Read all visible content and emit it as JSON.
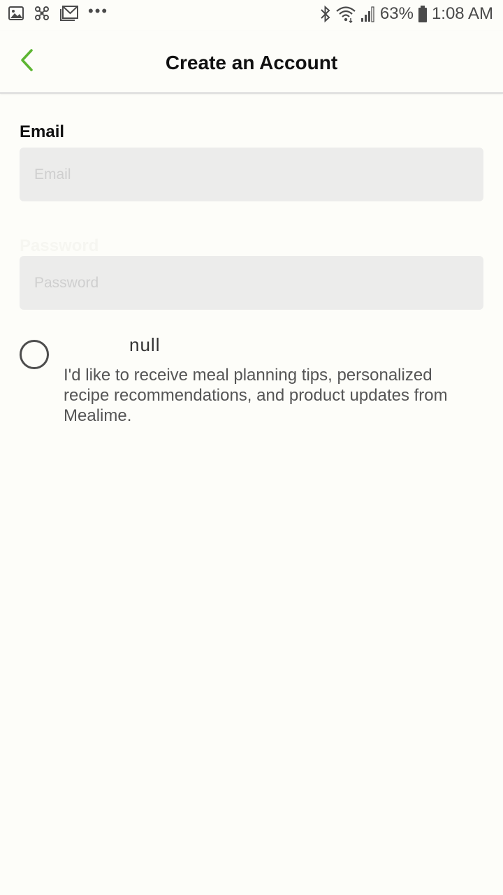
{
  "status_bar": {
    "battery": "63%",
    "time": "1:08 AM",
    "overflow": "•••",
    "icons": [
      "image-icon",
      "fan-icon",
      "gmail-icon",
      "bluetooth-icon",
      "wifi-icon",
      "signal-icon",
      "battery-icon"
    ]
  },
  "header": {
    "title": "Create an Account",
    "back_icon": "chevron-left-icon"
  },
  "form": {
    "email_label": "Email",
    "email_placeholder": "Email",
    "email_value": "",
    "password_label": "Password",
    "password_placeholder": "Password",
    "password_value": "",
    "radio_caption": "null",
    "consent_text": "I'd like to receive meal planning tips, personalized recipe recommendations, and product updates from Mealime.",
    "consent_checked": false
  },
  "colors": {
    "accent": "#5cb531",
    "background": "#fdfdf9",
    "input_bg": "#ececeb"
  }
}
